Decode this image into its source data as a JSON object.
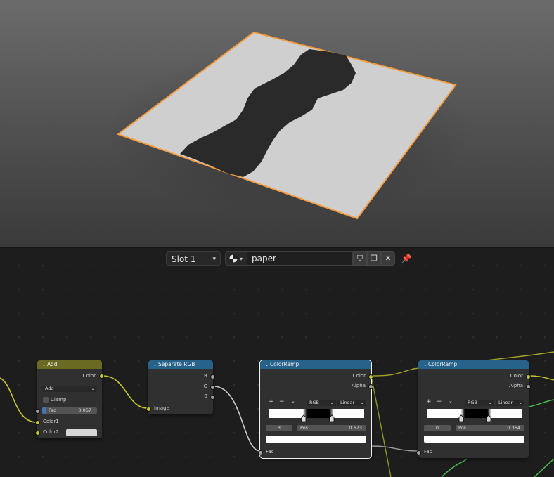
{
  "viewport": {
    "object_outline_color": "#f59b3d",
    "paper_color": "#cfcfcf"
  },
  "header": {
    "slot_label": "Slot 1",
    "material_name": "paper",
    "icons": [
      "material-sphere-icon",
      "fake-user-shield-icon",
      "duplicate-icon",
      "close-icon",
      "pin-icon"
    ]
  },
  "nodes": {
    "add": {
      "title": "Add",
      "output": "Color",
      "blend_mode": "Add",
      "clamp_label": "Clamp",
      "fac_label": "Fac",
      "fac_value": "0.067",
      "color1": "Color1",
      "color2": "Color2",
      "header_color": "#6a6a22"
    },
    "separate": {
      "title": "Separate RGB",
      "outputs": [
        "R",
        "G",
        "B"
      ],
      "input": "Image",
      "header_color": "#26628a"
    },
    "ramp1": {
      "title": "ColorRamp",
      "out_color": "Color",
      "out_alpha": "Alpha",
      "color_mode": "RGB",
      "interpolation": "Linear",
      "index": "3",
      "pos_label": "Pos",
      "pos_value": "0.673",
      "input": "Fac"
    },
    "ramp2": {
      "title": "ColorRamp",
      "out_color": "Color",
      "out_alpha": "Alpha",
      "color_mode": "RGB",
      "interpolation": "Linear",
      "index": "0",
      "pos_label": "Pos",
      "pos_value": "0.364",
      "input": "Fac"
    }
  }
}
